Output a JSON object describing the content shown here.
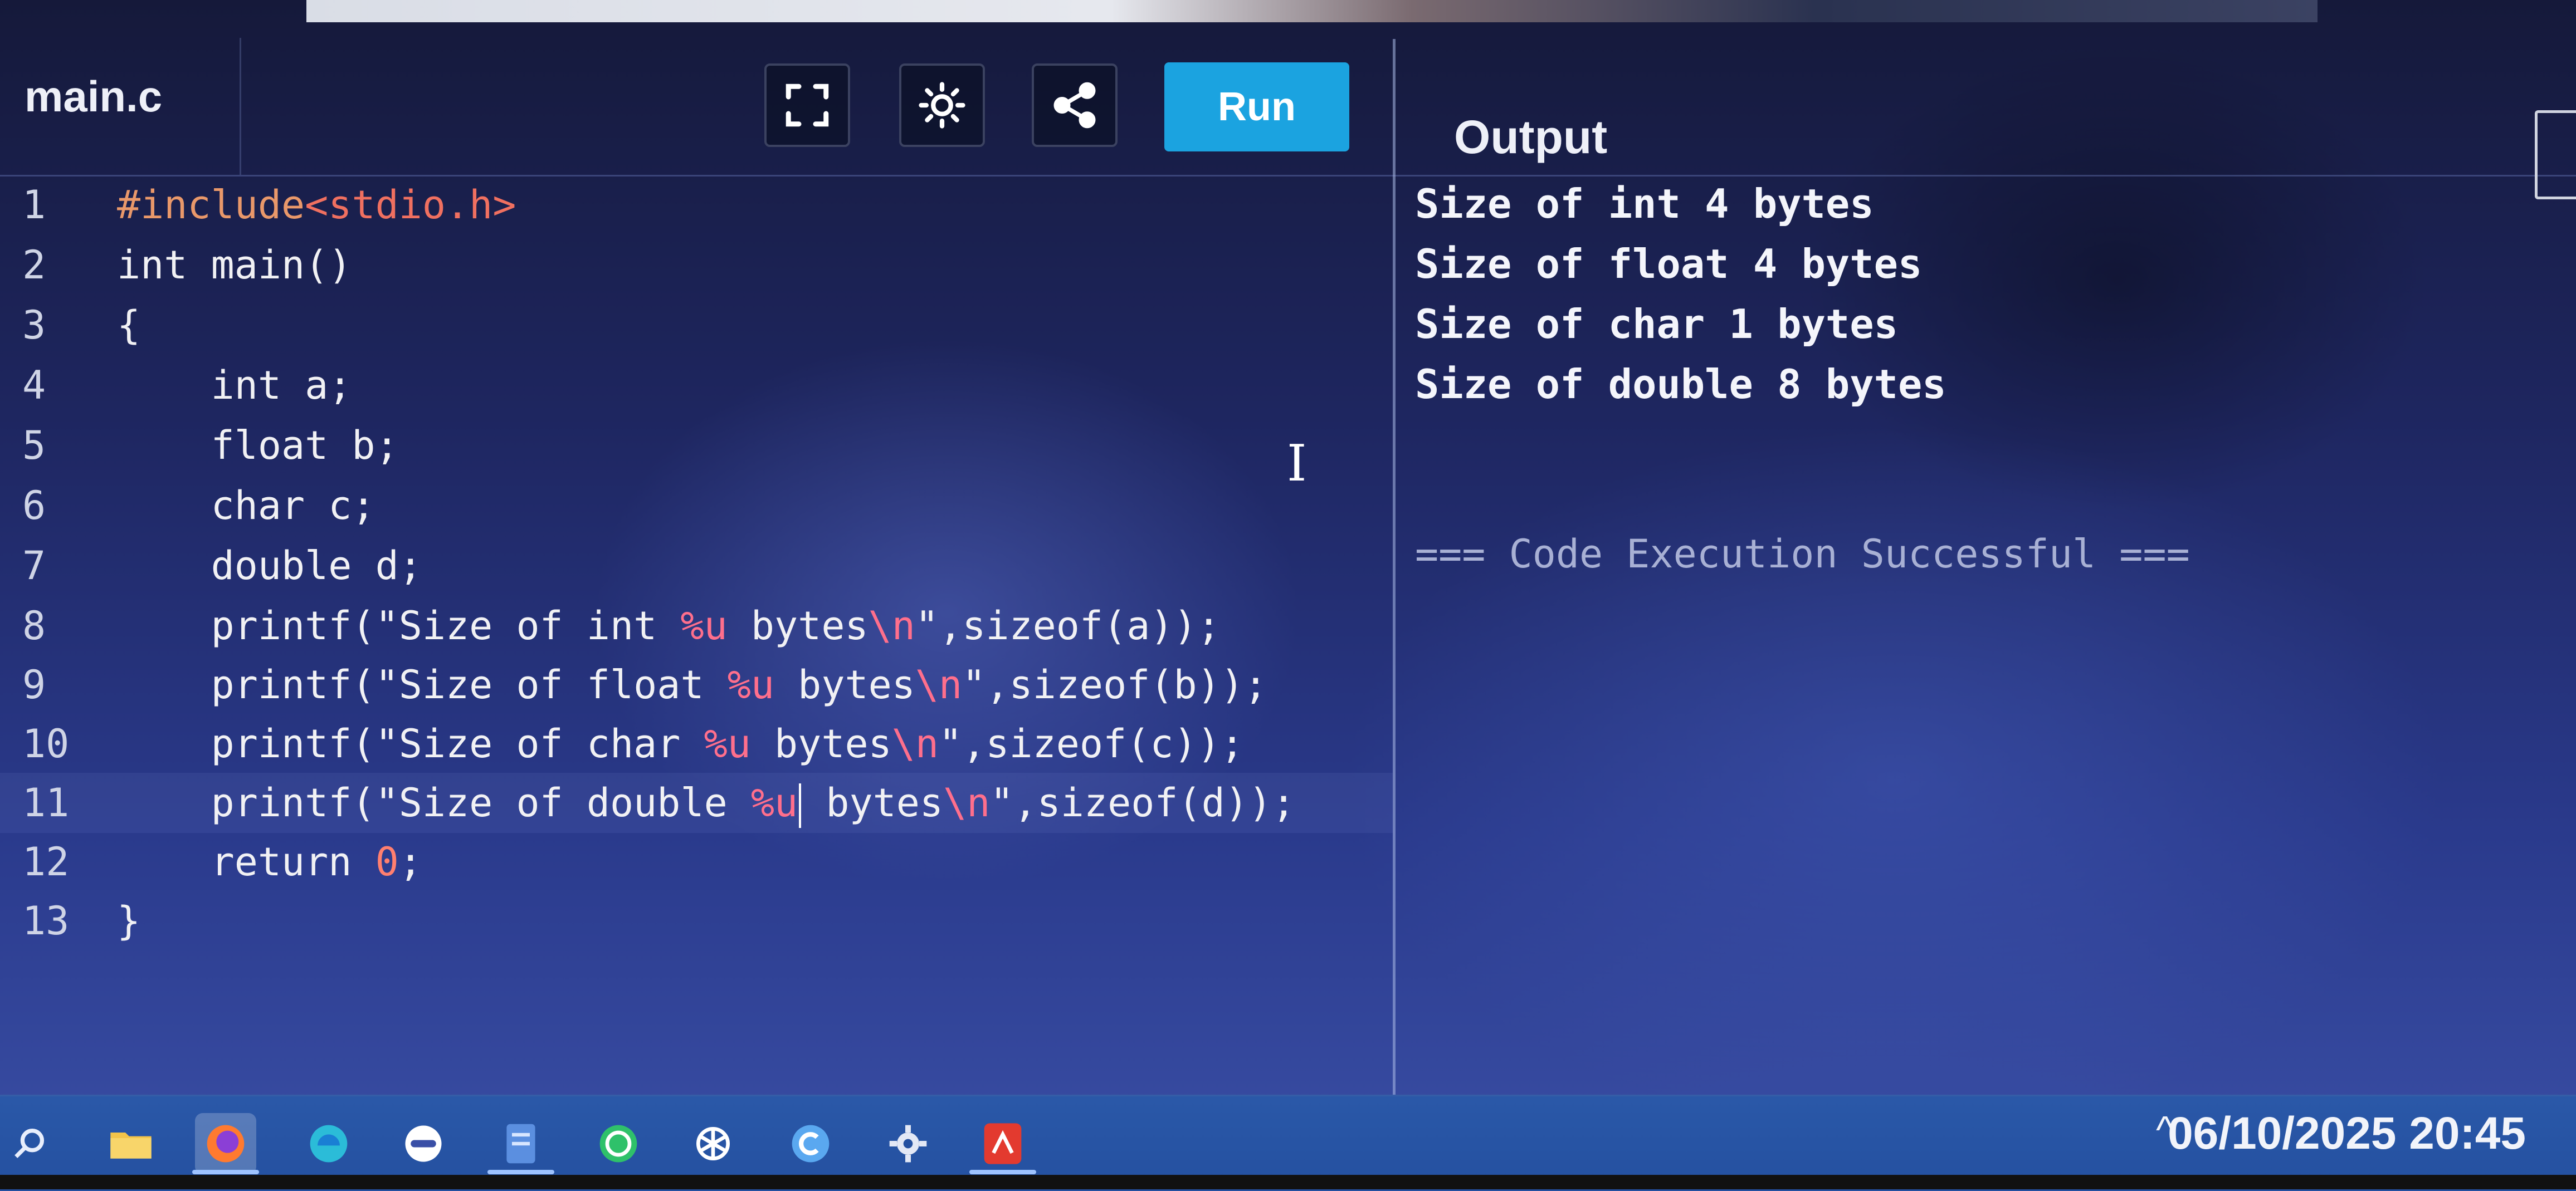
{
  "editor": {
    "filename": "main.c",
    "run_label": "Run",
    "lines": [
      {
        "n": "1",
        "segments": [
          {
            "t": "#include",
            "c": "pp"
          },
          {
            "t": "<stdio.h>",
            "c": "hdr"
          }
        ]
      },
      {
        "n": "2",
        "segments": [
          {
            "t": "int main()",
            "c": ""
          }
        ]
      },
      {
        "n": "3",
        "segments": [
          {
            "t": "{",
            "c": ""
          }
        ]
      },
      {
        "n": "4",
        "segments": [
          {
            "t": "    int a;",
            "c": ""
          }
        ]
      },
      {
        "n": "5",
        "segments": [
          {
            "t": "    float b;",
            "c": ""
          }
        ]
      },
      {
        "n": "6",
        "segments": [
          {
            "t": "    char c;",
            "c": ""
          }
        ]
      },
      {
        "n": "7",
        "segments": [
          {
            "t": "    double d;",
            "c": ""
          }
        ]
      },
      {
        "n": "8",
        "segments": [
          {
            "t": "    printf(\"Size of int ",
            "c": ""
          },
          {
            "t": "%u",
            "c": "fmt"
          },
          {
            "t": " bytes",
            "c": ""
          },
          {
            "t": "\\n",
            "c": "fmt"
          },
          {
            "t": "\",sizeof(a));",
            "c": ""
          }
        ]
      },
      {
        "n": "9",
        "segments": [
          {
            "t": "    printf(\"Size of float ",
            "c": ""
          },
          {
            "t": "%u",
            "c": "fmt"
          },
          {
            "t": " bytes",
            "c": ""
          },
          {
            "t": "\\n",
            "c": "fmt"
          },
          {
            "t": "\",sizeof(b));",
            "c": ""
          }
        ]
      },
      {
        "n": "10",
        "segments": [
          {
            "t": "    printf(\"Size of char ",
            "c": ""
          },
          {
            "t": "%u",
            "c": "fmt"
          },
          {
            "t": " bytes",
            "c": ""
          },
          {
            "t": "\\n",
            "c": "fmt"
          },
          {
            "t": "\",sizeof(c));",
            "c": ""
          }
        ]
      },
      {
        "n": "11",
        "segments": [
          {
            "t": "    printf(\"Size of double ",
            "c": ""
          },
          {
            "t": "%u",
            "c": "fmt"
          },
          {
            "t": " bytes",
            "c": ""
          },
          {
            "t": "\\n",
            "c": "fmt"
          },
          {
            "t": "\",sizeof(d));",
            "c": ""
          }
        ]
      },
      {
        "n": "12",
        "segments": [
          {
            "t": "    return ",
            "c": ""
          },
          {
            "t": "0",
            "c": "num"
          },
          {
            "t": ";",
            "c": ""
          }
        ]
      },
      {
        "n": "13",
        "segments": [
          {
            "t": "}",
            "c": ""
          }
        ]
      }
    ]
  },
  "output": {
    "title": "Output",
    "lines": [
      "Size of int 4 bytes",
      "Size of float 4 bytes",
      "Size of char 1 bytes",
      "Size of double 8 bytes"
    ],
    "status": "=== Code Execution Successful ==="
  },
  "taskbar": {
    "datetime": "06/10/2025 20:45",
    "tray_arrow": "^"
  },
  "icons": {
    "fullscreen": "fullscreen-icon",
    "theme": "sun-icon",
    "share": "share-icon",
    "search": "search-icon"
  },
  "colors": {
    "run_button": "#1ba3e0",
    "taskbar": "#2a58a8"
  }
}
